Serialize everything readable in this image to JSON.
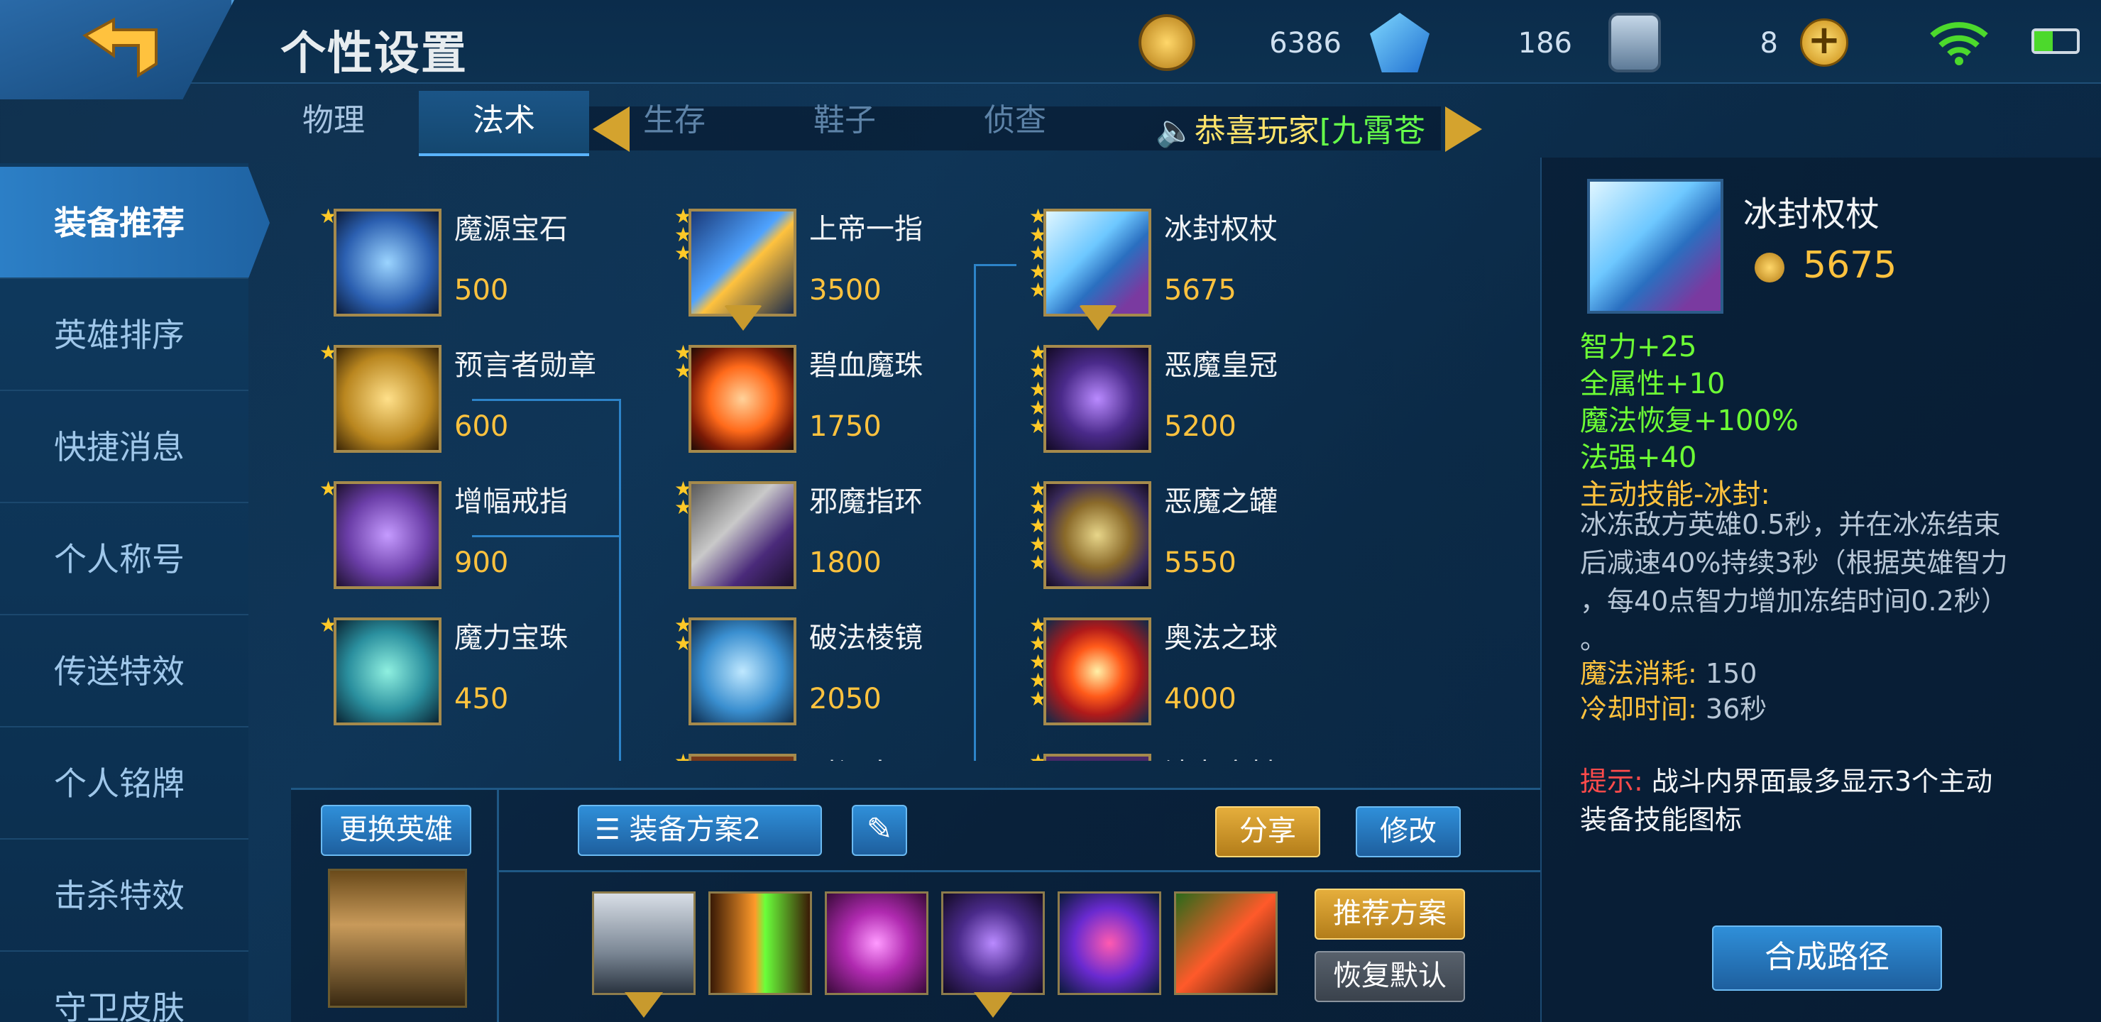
{
  "header": {
    "title": "个性设置",
    "resources": [
      {
        "name": "gold-coin",
        "value": "6386"
      },
      {
        "name": "diamond",
        "value": "186"
      },
      {
        "name": "voucher",
        "value": "8"
      }
    ]
  },
  "tabs": [
    "物理",
    "法术",
    "生存",
    "鞋子",
    "侦查"
  ],
  "active_tab": "法术",
  "notice": {
    "prefix": "恭喜玩家",
    "highlight": "[九霄苍"
  },
  "nav": [
    "装备推荐",
    "英雄排序",
    "快捷消息",
    "个人称号",
    "传送特效",
    "个人铭牌",
    "击杀特效",
    "守卫皮肤"
  ],
  "active_nav": "装备推荐",
  "items": {
    "col1": [
      {
        "name": "魔源宝石",
        "price": "500",
        "stars": 1
      },
      {
        "name": "预言者勋章",
        "price": "600",
        "stars": 1
      },
      {
        "name": "增幅戒指",
        "price": "900",
        "stars": 1
      },
      {
        "name": "魔力宝珠",
        "price": "450",
        "stars": 1
      }
    ],
    "col2": [
      {
        "name": "上帝一指",
        "price": "3500",
        "stars": 3
      },
      {
        "name": "碧血魔珠",
        "price": "1750",
        "stars": 2
      },
      {
        "name": "邪魔指环",
        "price": "1800",
        "stars": 2
      },
      {
        "name": "破法棱镜",
        "price": "2050",
        "stars": 2
      },
      {
        "name": "时间皇冠",
        "price": "",
        "stars": 2
      }
    ],
    "col3": [
      {
        "name": "冰封权杖",
        "price": "5675",
        "stars": 5
      },
      {
        "name": "恶魔皇冠",
        "price": "5200",
        "stars": 5
      },
      {
        "name": "恶魔之罐",
        "price": "5550",
        "stars": 5
      },
      {
        "name": "奥法之球",
        "price": "4000",
        "stars": 5
      },
      {
        "name": "法老魔杖",
        "price": "",
        "stars": 5
      }
    ]
  },
  "bottom": {
    "change_hero": "更换英雄",
    "plan": "装备方案2",
    "share": "分享",
    "modify": "修改",
    "recommend": "推荐方案",
    "restore": "恢复默认"
  },
  "detail": {
    "name": "冰封权杖",
    "price": "5675",
    "stats": [
      "智力+25",
      "全属性+10",
      "魔法恢复+100%",
      "法强+40"
    ],
    "active_title": "主动技能-冰封:",
    "active_desc": [
      "冰冻敌方英雄0.5秒，并在冰冻结束",
      "后减速40%持续3秒（根据英雄智力",
      "，每40点智力增加冻结时间0.2秒）",
      "。"
    ],
    "mana_label": "魔法消耗:",
    "mana_value": "150",
    "cd_label": "冷却时间:",
    "cd_value": "36秒",
    "tip_label": "提示:",
    "tip_text": "战斗内界面最多显示3个主动",
    "tip_text2": "装备技能图标",
    "path_button": "合成路径"
  },
  "colors": {
    "accent": "#2c7fc6",
    "gold": "#ffc23e",
    "stat_green": "#6dff35",
    "tip_red": "#ff4b4b"
  }
}
